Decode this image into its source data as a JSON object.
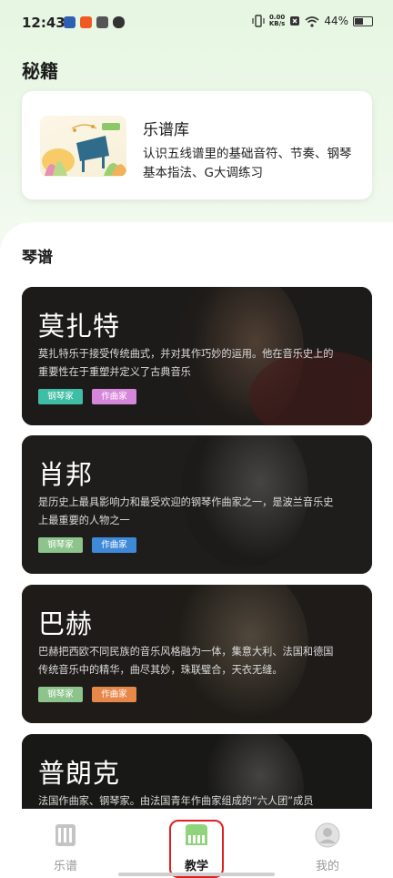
{
  "status": {
    "time": "12:43",
    "net_speed": "0.00",
    "net_unit": "KB/s",
    "battery": "44%",
    "app_colors": [
      "#2f5fb3",
      "#f05a22",
      "#555555",
      "#333333"
    ]
  },
  "secrets": {
    "title": "秘籍",
    "card": {
      "title": "乐谱库",
      "desc": "认识五线谱里的基础音符、节奏、钢琴基本指法、G大调练习"
    }
  },
  "sheets": {
    "title": "琴谱",
    "composers": [
      {
        "name": "莫扎特",
        "desc": "莫扎特乐于接受传统曲式，并对其作巧妙的运用。他在音乐史上的重要性在于重塑并定义了古典音乐",
        "tags": [
          {
            "label": "钢琴家",
            "color": "#3fbea5"
          },
          {
            "label": "作曲家",
            "color": "#d687d9"
          }
        ]
      },
      {
        "name": "肖邦",
        "desc": "是历史上最具影响力和最受欢迎的钢琴作曲家之一，是波兰音乐史上最重要的人物之一",
        "tags": [
          {
            "label": "钢琴家",
            "color": "#8cc48c"
          },
          {
            "label": "作曲家",
            "color": "#3f8ad8"
          }
        ]
      },
      {
        "name": "巴赫",
        "desc": "巴赫把西欧不同民族的音乐风格融为一体，集意大利、法国和德国传统音乐中的精华，曲尽其妙，珠联璧合，天衣无缝。",
        "tags": [
          {
            "label": "钢琴家",
            "color": "#8cc48c"
          },
          {
            "label": "作曲家",
            "color": "#e8874a"
          }
        ]
      },
      {
        "name": "普朗克",
        "desc": "法国作曲家、钢琴家。由法国青年作曲家组成的“六人团”成员",
        "tags": []
      }
    ]
  },
  "nav": {
    "items": [
      {
        "label": "乐谱",
        "icon": "music-score-icon",
        "active": false
      },
      {
        "label": "教学",
        "icon": "piano-icon",
        "active": true
      },
      {
        "label": "我的",
        "icon": "user-avatar-icon",
        "active": false
      }
    ]
  },
  "colors": {
    "accent": "#8fd47c",
    "highlight": "#e02020"
  }
}
